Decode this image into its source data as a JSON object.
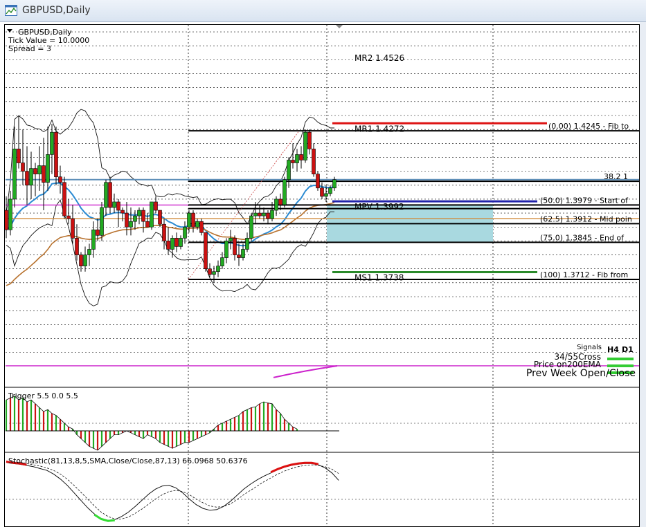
{
  "window": {
    "title": "GBPUSD,Daily"
  },
  "chart_data": {
    "type": "candlestick",
    "symbol_label": "GBPUSD,Daily",
    "info_lines": [
      "Tick Value = 10.0000",
      "Spread = 3"
    ],
    "ylim": [
      1.333,
      1.4625
    ],
    "candles": [
      {
        "o": 1.396,
        "h": 1.401,
        "l": 1.386,
        "c": 1.389
      },
      {
        "o": 1.389,
        "h": 1.403,
        "l": 1.387,
        "c": 1.4
      },
      {
        "o": 1.4,
        "h": 1.426,
        "l": 1.397,
        "c": 1.418
      },
      {
        "o": 1.418,
        "h": 1.43,
        "l": 1.411,
        "c": 1.413
      },
      {
        "o": 1.413,
        "h": 1.425,
        "l": 1.405,
        "c": 1.41
      },
      {
        "o": 1.41,
        "h": 1.419,
        "l": 1.398,
        "c": 1.405
      },
      {
        "o": 1.405,
        "h": 1.417,
        "l": 1.4,
        "c": 1.411
      },
      {
        "o": 1.411,
        "h": 1.413,
        "l": 1.401,
        "c": 1.409
      },
      {
        "o": 1.409,
        "h": 1.419,
        "l": 1.403,
        "c": 1.412
      },
      {
        "o": 1.412,
        "h": 1.422,
        "l": 1.396,
        "c": 1.406
      },
      {
        "o": 1.406,
        "h": 1.426,
        "l": 1.403,
        "c": 1.416
      },
      {
        "o": 1.416,
        "h": 1.427,
        "l": 1.409,
        "c": 1.424
      },
      {
        "o": 1.424,
        "h": 1.426,
        "l": 1.405,
        "c": 1.408
      },
      {
        "o": 1.408,
        "h": 1.412,
        "l": 1.402,
        "c": 1.406
      },
      {
        "o": 1.406,
        "h": 1.408,
        "l": 1.393,
        "c": 1.394
      },
      {
        "o": 1.394,
        "h": 1.4,
        "l": 1.391,
        "c": 1.393
      },
      {
        "o": 1.393,
        "h": 1.398,
        "l": 1.384,
        "c": 1.386
      },
      {
        "o": 1.386,
        "h": 1.391,
        "l": 1.378,
        "c": 1.38
      },
      {
        "o": 1.38,
        "h": 1.381,
        "l": 1.374,
        "c": 1.376
      },
      {
        "o": 1.376,
        "h": 1.383,
        "l": 1.374,
        "c": 1.38
      },
      {
        "o": 1.38,
        "h": 1.384,
        "l": 1.376,
        "c": 1.382
      },
      {
        "o": 1.382,
        "h": 1.392,
        "l": 1.379,
        "c": 1.389
      },
      {
        "o": 1.389,
        "h": 1.393,
        "l": 1.385,
        "c": 1.387
      },
      {
        "o": 1.387,
        "h": 1.399,
        "l": 1.385,
        "c": 1.397
      },
      {
        "o": 1.397,
        "h": 1.407,
        "l": 1.394,
        "c": 1.406
      },
      {
        "o": 1.406,
        "h": 1.408,
        "l": 1.395,
        "c": 1.397
      },
      {
        "o": 1.397,
        "h": 1.402,
        "l": 1.395,
        "c": 1.399
      },
      {
        "o": 1.399,
        "h": 1.4,
        "l": 1.39,
        "c": 1.396
      },
      {
        "o": 1.396,
        "h": 1.397,
        "l": 1.392,
        "c": 1.395
      },
      {
        "o": 1.395,
        "h": 1.399,
        "l": 1.387,
        "c": 1.39
      },
      {
        "o": 1.39,
        "h": 1.397,
        "l": 1.387,
        "c": 1.392
      },
      {
        "o": 1.392,
        "h": 1.396,
        "l": 1.389,
        "c": 1.394
      },
      {
        "o": 1.394,
        "h": 1.397,
        "l": 1.391,
        "c": 1.396
      },
      {
        "o": 1.396,
        "h": 1.397,
        "l": 1.388,
        "c": 1.392
      },
      {
        "o": 1.392,
        "h": 1.395,
        "l": 1.39,
        "c": 1.39
      },
      {
        "o": 1.39,
        "h": 1.399,
        "l": 1.389,
        "c": 1.399
      },
      {
        "o": 1.399,
        "h": 1.401,
        "l": 1.395,
        "c": 1.396
      },
      {
        "o": 1.396,
        "h": 1.396,
        "l": 1.39,
        "c": 1.391
      },
      {
        "o": 1.391,
        "h": 1.393,
        "l": 1.382,
        "c": 1.385
      },
      {
        "o": 1.385,
        "h": 1.39,
        "l": 1.38,
        "c": 1.382
      },
      {
        "o": 1.382,
        "h": 1.387,
        "l": 1.379,
        "c": 1.386
      },
      {
        "o": 1.386,
        "h": 1.388,
        "l": 1.381,
        "c": 1.383
      },
      {
        "o": 1.383,
        "h": 1.387,
        "l": 1.382,
        "c": 1.386
      },
      {
        "o": 1.386,
        "h": 1.392,
        "l": 1.384,
        "c": 1.39
      },
      {
        "o": 1.39,
        "h": 1.396,
        "l": 1.388,
        "c": 1.395
      },
      {
        "o": 1.395,
        "h": 1.396,
        "l": 1.388,
        "c": 1.39
      },
      {
        "o": 1.39,
        "h": 1.393,
        "l": 1.389,
        "c": 1.392
      },
      {
        "o": 1.392,
        "h": 1.393,
        "l": 1.387,
        "c": 1.388
      },
      {
        "o": 1.388,
        "h": 1.388,
        "l": 1.374,
        "c": 1.375
      },
      {
        "o": 1.375,
        "h": 1.377,
        "l": 1.372,
        "c": 1.373
      },
      {
        "o": 1.373,
        "h": 1.376,
        "l": 1.37,
        "c": 1.374
      },
      {
        "o": 1.374,
        "h": 1.378,
        "l": 1.372,
        "c": 1.376
      },
      {
        "o": 1.376,
        "h": 1.381,
        "l": 1.375,
        "c": 1.379
      },
      {
        "o": 1.379,
        "h": 1.386,
        "l": 1.377,
        "c": 1.385
      },
      {
        "o": 1.385,
        "h": 1.389,
        "l": 1.382,
        "c": 1.386
      },
      {
        "o": 1.386,
        "h": 1.387,
        "l": 1.378,
        "c": 1.38
      },
      {
        "o": 1.38,
        "h": 1.384,
        "l": 1.376,
        "c": 1.379
      },
      {
        "o": 1.379,
        "h": 1.384,
        "l": 1.378,
        "c": 1.382
      },
      {
        "o": 1.382,
        "h": 1.388,
        "l": 1.381,
        "c": 1.386
      },
      {
        "o": 1.386,
        "h": 1.395,
        "l": 1.385,
        "c": 1.394
      },
      {
        "o": 1.394,
        "h": 1.399,
        "l": 1.391,
        "c": 1.395
      },
      {
        "o": 1.395,
        "h": 1.398,
        "l": 1.393,
        "c": 1.394
      },
      {
        "o": 1.394,
        "h": 1.397,
        "l": 1.392,
        "c": 1.395
      },
      {
        "o": 1.395,
        "h": 1.396,
        "l": 1.391,
        "c": 1.393
      },
      {
        "o": 1.393,
        "h": 1.399,
        "l": 1.392,
        "c": 1.396
      },
      {
        "o": 1.396,
        "h": 1.401,
        "l": 1.394,
        "c": 1.4
      },
      {
        "o": 1.4,
        "h": 1.402,
        "l": 1.396,
        "c": 1.398
      },
      {
        "o": 1.398,
        "h": 1.408,
        "l": 1.397,
        "c": 1.407
      },
      {
        "o": 1.407,
        "h": 1.415,
        "l": 1.404,
        "c": 1.414
      },
      {
        "o": 1.414,
        "h": 1.42,
        "l": 1.411,
        "c": 1.413
      },
      {
        "o": 1.413,
        "h": 1.418,
        "l": 1.41,
        "c": 1.416
      },
      {
        "o": 1.416,
        "h": 1.419,
        "l": 1.411,
        "c": 1.414
      },
      {
        "o": 1.414,
        "h": 1.425,
        "l": 1.413,
        "c": 1.424
      },
      {
        "o": 1.424,
        "h": 1.425,
        "l": 1.416,
        "c": 1.418
      },
      {
        "o": 1.418,
        "h": 1.42,
        "l": 1.408,
        "c": 1.409
      },
      {
        "o": 1.409,
        "h": 1.41,
        "l": 1.403,
        "c": 1.404
      },
      {
        "o": 1.404,
        "h": 1.406,
        "l": 1.4,
        "c": 1.401
      },
      {
        "o": 1.401,
        "h": 1.405,
        "l": 1.399,
        "c": 1.402
      },
      {
        "o": 1.402,
        "h": 1.405,
        "l": 1.401,
        "c": 1.404
      },
      {
        "o": 1.404,
        "h": 1.408,
        "l": 1.403,
        "c": 1.407
      }
    ],
    "levels": [
      {
        "name": "MR2",
        "label": "MR2   1.4526",
        "value": 1.4526,
        "color": "#888888"
      },
      {
        "name": "MR1",
        "label": "MR1   1.4272",
        "value": 1.4272,
        "color": "#dd1111"
      },
      {
        "name": "MPV",
        "label": "MPV   1.3992",
        "value": 1.3992,
        "color": "#2222aa"
      },
      {
        "name": "MS1",
        "label": "MS1   1.3738",
        "value": 1.3738,
        "color": "#2a8a2a"
      }
    ],
    "fib_levels": [
      {
        "label": "(0.00)   1.4245  -  Fib to",
        "value": 1.4245
      },
      {
        "label": "38.2     1",
        "value": 1.4064
      },
      {
        "label": "(50.0)  1.3979  -  Start of",
        "value": 1.3979
      },
      {
        "label": "(62.5)  1.3912  -  Mid poin",
        "value": 1.3912
      },
      {
        "label": "(75.0)   1.3845  -  End of",
        "value": 1.3845
      },
      {
        "label": "(100)   1.3712  -  Fib from",
        "value": 1.3712
      }
    ],
    "zone": {
      "top": 1.3979,
      "bottom": 1.3845
    },
    "signals": {
      "title": "Signals",
      "timeframes": [
        "H4",
        "D1"
      ],
      "rows": [
        "34/55Cross",
        "Price on200EMA",
        "Prev Week Open/Close"
      ],
      "color": "#33cc33"
    },
    "trigger": {
      "label": "Trigger 5.5  0.0  5.5",
      "values": [
        0.8,
        0.85,
        0.9,
        0.8,
        0.85,
        0.75,
        0.8,
        0.7,
        0.6,
        0.5,
        0.55,
        0.45,
        0.4,
        0.3,
        0.2,
        0.1,
        0.05,
        -0.1,
        -0.2,
        -0.3,
        -0.4,
        -0.45,
        -0.5,
        -0.4,
        -0.3,
        -0.2,
        -0.1,
        -0.1,
        -0.05,
        0.0,
        -0.05,
        -0.1,
        -0.15,
        -0.2,
        -0.1,
        -0.15,
        -0.2,
        -0.3,
        -0.35,
        -0.4,
        -0.45,
        -0.4,
        -0.35,
        -0.3,
        -0.3,
        -0.25,
        -0.2,
        -0.15,
        -0.1,
        -0.05,
        0.05,
        0.15,
        0.2,
        0.25,
        0.3,
        0.35,
        0.4,
        0.5,
        0.55,
        0.6,
        0.62,
        0.7,
        0.75,
        0.72,
        0.7,
        0.55,
        0.45,
        0.3,
        0.2,
        0.1,
        0.05
      ]
    },
    "stochastic": {
      "label": "Stochastic(81,13,8,5,SMA,Close/Close,87,13) 66.0968 50.6376",
      "main": [
        95,
        93,
        92,
        90,
        88,
        85,
        82,
        76,
        68,
        58,
        46,
        34,
        22,
        12,
        5,
        2,
        3,
        8,
        15,
        24,
        34,
        44,
        52,
        57,
        58,
        54,
        46,
        36,
        27,
        21,
        18,
        19,
        24,
        32,
        42,
        52,
        60,
        67,
        73,
        78,
        83,
        87,
        90,
        92,
        93,
        93,
        91,
        86,
        78,
        66
      ],
      "signal": [
        97,
        96,
        95,
        93,
        91,
        89,
        86,
        82,
        76,
        68,
        58,
        47,
        36,
        25,
        15,
        8,
        4,
        4,
        7,
        13,
        20,
        28,
        36,
        43,
        48,
        50,
        48,
        43,
        36,
        30,
        25,
        23,
        24,
        28,
        35,
        43,
        50,
        57,
        64,
        70,
        76,
        81,
        85,
        88,
        90,
        91,
        90,
        88,
        84,
        77
      ]
    }
  }
}
